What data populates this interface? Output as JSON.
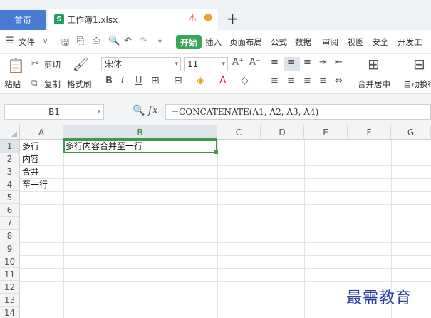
{
  "tabs": {
    "home": "首页",
    "file_icon": "S",
    "file_name": "工作簿1.xlsx"
  },
  "menu": {
    "file": "文件",
    "start": "开始",
    "items": [
      "插入",
      "页面布局",
      "公式",
      "数据",
      "审阅",
      "视图",
      "安全",
      "开发工"
    ]
  },
  "ribbon": {
    "paste": "粘贴",
    "cut": "剪切",
    "copy": "复制",
    "format_painter": "格式刷",
    "font_name": "宋体",
    "font_size": "11",
    "merge_center": "合并居中",
    "auto_wrap": "自动换行"
  },
  "formula_bar": {
    "name_box": "B1",
    "fx": "fx",
    "formula": "=CONCATENATE(A1, A2, A3, A4)"
  },
  "sheet": {
    "columns": [
      "A",
      "B",
      "C",
      "D",
      "E",
      "F",
      "G"
    ],
    "rows": [
      "1",
      "2",
      "3",
      "4",
      "5",
      "6",
      "7",
      "8",
      "9",
      "10",
      "11",
      "12",
      "13",
      "14"
    ],
    "cells": {
      "A1": "多行",
      "A2": "内容",
      "A3": "合并",
      "A4": "至一行",
      "B1": "多行内容合并至一行"
    },
    "selected": "B1"
  },
  "watermark": "最需教育",
  "colors": {
    "accent_green": "#3c9a48",
    "tab_blue": "#4a7bd4"
  }
}
